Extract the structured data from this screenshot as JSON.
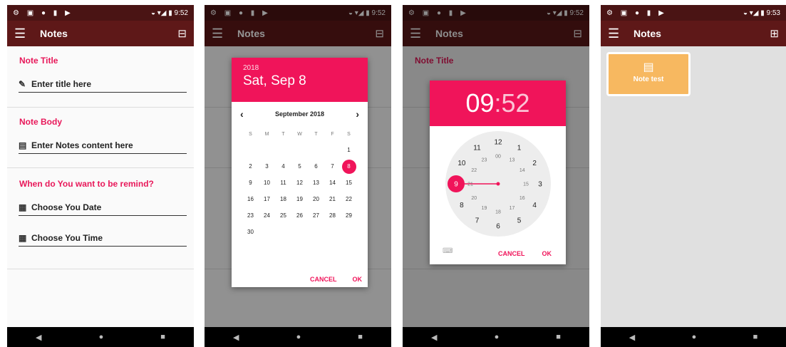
{
  "status_left": "⚙ ▣ ● ▮ ▶",
  "screen1": {
    "time": "9:52",
    "app_title": "Notes",
    "note_title_label": "Note Title",
    "title_placeholder": "Enter title here",
    "note_body_label": "Note Body",
    "body_placeholder": "Enter Notes content here",
    "remind_label": "When do You want to be remind?",
    "date_label": "Choose You Date",
    "time_label": "Choose You Time"
  },
  "screen2": {
    "time": "9:52",
    "app_title": "Notes",
    "date_dialog": {
      "year": "2018",
      "date": "Sat, Sep 8",
      "month_title": "September 2018",
      "weekdays": [
        "S",
        "M",
        "T",
        "W",
        "T",
        "F",
        "S"
      ],
      "weeks": [
        [
          "",
          "",
          "",
          "",
          "",
          "",
          "1"
        ],
        [
          "2",
          "3",
          "4",
          "5",
          "6",
          "7",
          "8"
        ],
        [
          "9",
          "10",
          "11",
          "12",
          "13",
          "14",
          "15"
        ],
        [
          "16",
          "17",
          "18",
          "19",
          "20",
          "21",
          "22"
        ],
        [
          "23",
          "24",
          "25",
          "26",
          "27",
          "28",
          "29"
        ],
        [
          "30",
          "",
          "",
          "",
          "",
          "",
          ""
        ]
      ],
      "selected_day": "8",
      "cancel": "CANCEL",
      "ok": "OK"
    }
  },
  "screen3": {
    "time": "9:52",
    "app_title": "Notes",
    "time_dialog": {
      "hour": "09",
      "colon": ":",
      "minute": "52",
      "outer_numbers": [
        "12",
        "1",
        "2",
        "3",
        "4",
        "5",
        "6",
        "7",
        "8",
        "9",
        "10",
        "11"
      ],
      "inner_numbers": [
        "00",
        "13",
        "14",
        "15",
        "16",
        "17",
        "18",
        "19",
        "20",
        "21",
        "22",
        "23"
      ],
      "selected_hour": "9",
      "cancel": "CANCEL",
      "ok": "OK"
    }
  },
  "screen4": {
    "time": "9:53",
    "app_title": "Notes",
    "note_card_title": "Note test"
  },
  "colors": {
    "appbar": "#5e1818",
    "statusbar": "#4a1414",
    "accent": "#f0145a",
    "card": "#f7b860"
  }
}
